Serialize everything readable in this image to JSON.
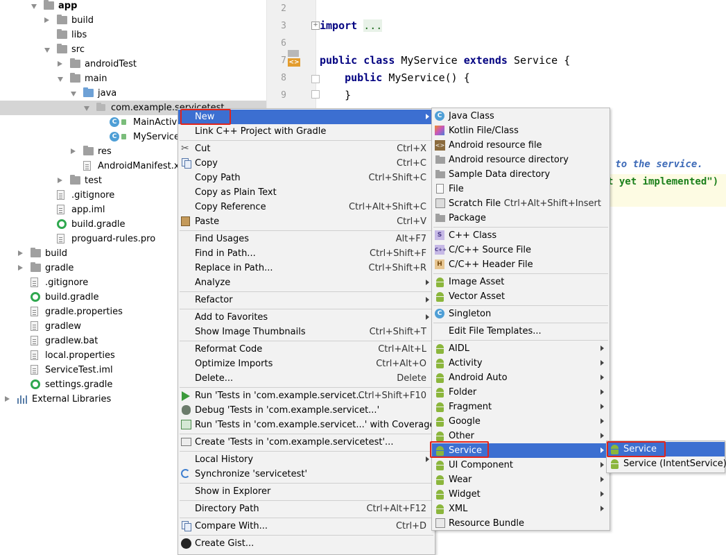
{
  "project_tree": [
    {
      "label": "app",
      "level": 2,
      "expand": "down",
      "icon": "module-folder-icon",
      "bold": true
    },
    {
      "label": "build",
      "level": 3,
      "expand": "right",
      "icon": "folder-icon"
    },
    {
      "label": "libs",
      "level": 3,
      "expand": "none",
      "icon": "folder-icon"
    },
    {
      "label": "src",
      "level": 3,
      "expand": "down",
      "icon": "folder-icon"
    },
    {
      "label": "androidTest",
      "level": 4,
      "expand": "right",
      "icon": "folder-icon"
    },
    {
      "label": "main",
      "level": 4,
      "expand": "down",
      "icon": "folder-icon"
    },
    {
      "label": "java",
      "level": 5,
      "expand": "down",
      "icon": "source-folder-icon"
    },
    {
      "label": "com.example.servicetest",
      "level": 6,
      "expand": "down",
      "icon": "package-icon",
      "selected": true
    },
    {
      "label": "MainActivity",
      "level": 7,
      "expand": "none",
      "icon": "class-icon"
    },
    {
      "label": "MyService",
      "level": 7,
      "expand": "none",
      "icon": "class-icon"
    },
    {
      "label": "res",
      "level": 5,
      "expand": "right",
      "icon": "resource-folder-icon"
    },
    {
      "label": "AndroidManifest.xml",
      "level": 5,
      "expand": "none",
      "icon": "manifest-file-icon"
    },
    {
      "label": "test",
      "level": 4,
      "expand": "right",
      "icon": "folder-icon"
    },
    {
      "label": ".gitignore",
      "level": 3,
      "expand": "none",
      "icon": "file-icon"
    },
    {
      "label": "app.iml",
      "level": 3,
      "expand": "none",
      "icon": "file-icon"
    },
    {
      "label": "build.gradle",
      "level": 3,
      "expand": "none",
      "icon": "gradle-icon"
    },
    {
      "label": "proguard-rules.pro",
      "level": 3,
      "expand": "none",
      "icon": "file-icon"
    },
    {
      "label": "build",
      "level": 1,
      "expand": "right",
      "icon": "folder-icon"
    },
    {
      "label": "gradle",
      "level": 1,
      "expand": "right",
      "icon": "folder-icon"
    },
    {
      "label": ".gitignore",
      "level": 1,
      "expand": "none",
      "icon": "file-icon"
    },
    {
      "label": "build.gradle",
      "level": 1,
      "expand": "none",
      "icon": "gradle-icon"
    },
    {
      "label": "gradle.properties",
      "level": 1,
      "expand": "none",
      "icon": "properties-file-icon"
    },
    {
      "label": "gradlew",
      "level": 1,
      "expand": "none",
      "icon": "file-icon"
    },
    {
      "label": "gradlew.bat",
      "level": 1,
      "expand": "none",
      "icon": "file-icon"
    },
    {
      "label": "local.properties",
      "level": 1,
      "expand": "none",
      "icon": "properties-file-icon"
    },
    {
      "label": "ServiceTest.iml",
      "level": 1,
      "expand": "none",
      "icon": "file-icon"
    },
    {
      "label": "settings.gradle",
      "level": 1,
      "expand": "none",
      "icon": "gradle-icon"
    },
    {
      "label": "External Libraries",
      "level": 0,
      "expand": "right",
      "icon": "libraries-icon"
    }
  ],
  "editor": {
    "line_numbers": [
      "2",
      "3",
      "6",
      "7",
      "8",
      "9"
    ],
    "import_kw": "import",
    "import_fold": "...",
    "class_decl": {
      "kw1": "public",
      "kw2": "class",
      "name": "MyService",
      "kw3": "extends",
      "parent": "Service",
      "brace": "{"
    },
    "ctor_decl": {
      "kw": "public",
      "text": "MyService() {"
    },
    "close_brace": "}",
    "comment_fragment": "el to the service.",
    "string_fragment": "t yet implemented\")"
  },
  "context_menu": {
    "items": [
      {
        "type": "item",
        "label": "New",
        "shortcut": "",
        "submenu": true,
        "highlight": true,
        "icon": ""
      },
      {
        "type": "item",
        "label": "Link C++ Project with Gradle",
        "shortcut": "",
        "icon": ""
      },
      {
        "type": "sep"
      },
      {
        "type": "item",
        "label": "Cut",
        "shortcut": "Ctrl+X",
        "icon": "scissors-icon"
      },
      {
        "type": "item",
        "label": "Copy",
        "shortcut": "Ctrl+C",
        "icon": "copy-icon"
      },
      {
        "type": "item",
        "label": "Copy Path",
        "shortcut": "Ctrl+Shift+C",
        "icon": ""
      },
      {
        "type": "item",
        "label": "Copy as Plain Text",
        "shortcut": "",
        "icon": ""
      },
      {
        "type": "item",
        "label": "Copy Reference",
        "shortcut": "Ctrl+Alt+Shift+C",
        "icon": ""
      },
      {
        "type": "item",
        "label": "Paste",
        "shortcut": "Ctrl+V",
        "icon": "paste-icon"
      },
      {
        "type": "sep"
      },
      {
        "type": "item",
        "label": "Find Usages",
        "shortcut": "Alt+F7",
        "icon": ""
      },
      {
        "type": "item",
        "label": "Find in Path...",
        "shortcut": "Ctrl+Shift+F",
        "icon": ""
      },
      {
        "type": "item",
        "label": "Replace in Path...",
        "shortcut": "Ctrl+Shift+R",
        "icon": ""
      },
      {
        "type": "item",
        "label": "Analyze",
        "shortcut": "",
        "submenu": true,
        "icon": ""
      },
      {
        "type": "sep"
      },
      {
        "type": "item",
        "label": "Refactor",
        "shortcut": "",
        "submenu": true,
        "icon": ""
      },
      {
        "type": "sep"
      },
      {
        "type": "item",
        "label": "Add to Favorites",
        "shortcut": "",
        "submenu": true,
        "icon": ""
      },
      {
        "type": "item",
        "label": "Show Image Thumbnails",
        "shortcut": "Ctrl+Shift+T",
        "icon": ""
      },
      {
        "type": "sep"
      },
      {
        "type": "item",
        "label": "Reformat Code",
        "shortcut": "Ctrl+Alt+L",
        "icon": ""
      },
      {
        "type": "item",
        "label": "Optimize Imports",
        "shortcut": "Ctrl+Alt+O",
        "icon": ""
      },
      {
        "type": "item",
        "label": "Delete...",
        "shortcut": "Delete",
        "icon": ""
      },
      {
        "type": "sep"
      },
      {
        "type": "item",
        "label": "Run 'Tests in 'com.example.servicet...'",
        "shortcut": "Ctrl+Shift+F10",
        "icon": "run-icon"
      },
      {
        "type": "item",
        "label": "Debug 'Tests in 'com.example.servicet...'",
        "shortcut": "",
        "icon": "debug-icon"
      },
      {
        "type": "item",
        "label": "Run 'Tests in 'com.example.servicet...' with Coverage",
        "shortcut": "",
        "icon": "coverage-icon"
      },
      {
        "type": "sep"
      },
      {
        "type": "item",
        "label": "Create 'Tests in 'com.example.servicetest'...",
        "shortcut": "",
        "icon": "create-tests-icon"
      },
      {
        "type": "sep"
      },
      {
        "type": "item",
        "label": "Local History",
        "shortcut": "",
        "submenu": true,
        "icon": ""
      },
      {
        "type": "item",
        "label": "Synchronize 'servicetest'",
        "shortcut": "",
        "icon": "sync-icon"
      },
      {
        "type": "sep"
      },
      {
        "type": "item",
        "label": "Show in Explorer",
        "shortcut": "",
        "icon": ""
      },
      {
        "type": "sep"
      },
      {
        "type": "item",
        "label": "Directory Path",
        "shortcut": "Ctrl+Alt+F12",
        "icon": ""
      },
      {
        "type": "sep"
      },
      {
        "type": "item",
        "label": "Compare With...",
        "shortcut": "Ctrl+D",
        "icon": "compare-icon"
      },
      {
        "type": "sep"
      },
      {
        "type": "item",
        "label": "Create Gist...",
        "shortcut": "",
        "icon": "github-icon"
      }
    ]
  },
  "new_submenu": {
    "items": [
      {
        "type": "item",
        "label": "Java Class",
        "shortcut": "",
        "icon": "java-class-icon"
      },
      {
        "type": "item",
        "label": "Kotlin File/Class",
        "shortcut": "",
        "icon": "kotlin-icon"
      },
      {
        "type": "item",
        "label": "Android resource file",
        "shortcut": "",
        "icon": "resource-file-icon"
      },
      {
        "type": "item",
        "label": "Android resource directory",
        "shortcut": "",
        "icon": "folder-icon"
      },
      {
        "type": "item",
        "label": "Sample Data directory",
        "shortcut": "",
        "icon": "folder-icon"
      },
      {
        "type": "item",
        "label": "File",
        "shortcut": "",
        "icon": "file-icon"
      },
      {
        "type": "item",
        "label": "Scratch File",
        "shortcut": "Ctrl+Alt+Shift+Insert",
        "icon": "scratch-file-icon"
      },
      {
        "type": "item",
        "label": "Package",
        "shortcut": "",
        "icon": "folder-icon"
      },
      {
        "type": "sep"
      },
      {
        "type": "item",
        "label": "C++ Class",
        "shortcut": "",
        "icon": "cpp-class-icon"
      },
      {
        "type": "item",
        "label": "C/C++ Source File",
        "shortcut": "",
        "icon": "cpp-source-icon"
      },
      {
        "type": "item",
        "label": "C/C++ Header File",
        "shortcut": "",
        "icon": "cpp-header-icon"
      },
      {
        "type": "sep"
      },
      {
        "type": "item",
        "label": "Image Asset",
        "shortcut": "",
        "icon": "android-icon"
      },
      {
        "type": "item",
        "label": "Vector Asset",
        "shortcut": "",
        "icon": "android-icon"
      },
      {
        "type": "sep"
      },
      {
        "type": "item",
        "label": "Singleton",
        "shortcut": "",
        "icon": "java-class-icon"
      },
      {
        "type": "sep"
      },
      {
        "type": "item",
        "label": "Edit File Templates...",
        "shortcut": "",
        "icon": ""
      },
      {
        "type": "sep"
      },
      {
        "type": "item",
        "label": "AIDL",
        "submenu": true,
        "icon": "android-icon"
      },
      {
        "type": "item",
        "label": "Activity",
        "submenu": true,
        "icon": "android-icon"
      },
      {
        "type": "item",
        "label": "Android Auto",
        "submenu": true,
        "icon": "android-icon"
      },
      {
        "type": "item",
        "label": "Folder",
        "submenu": true,
        "icon": "android-icon"
      },
      {
        "type": "item",
        "label": "Fragment",
        "submenu": true,
        "icon": "android-icon"
      },
      {
        "type": "item",
        "label": "Google",
        "submenu": true,
        "icon": "android-icon"
      },
      {
        "type": "item",
        "label": "Other",
        "submenu": true,
        "icon": "android-icon"
      },
      {
        "type": "item",
        "label": "Service",
        "submenu": true,
        "icon": "android-icon",
        "highlight": true
      },
      {
        "type": "item",
        "label": "UI Component",
        "submenu": true,
        "icon": "android-icon"
      },
      {
        "type": "item",
        "label": "Wear",
        "submenu": true,
        "icon": "android-icon"
      },
      {
        "type": "item",
        "label": "Widget",
        "submenu": true,
        "icon": "android-icon"
      },
      {
        "type": "item",
        "label": "XML",
        "submenu": true,
        "icon": "android-icon"
      },
      {
        "type": "item",
        "label": "Resource Bundle",
        "shortcut": "",
        "icon": "resource-bundle-icon"
      }
    ]
  },
  "service_submenu": {
    "items": [
      {
        "label": "Service",
        "icon": "service-icon",
        "highlight": true
      },
      {
        "label": "Service (IntentService)",
        "icon": "service-icon"
      }
    ]
  },
  "colors": {
    "menu_highlight": "#3c6fd1",
    "red_outline": "#e2231a",
    "keyword": "#000080",
    "android_green": "#8bb63c"
  }
}
